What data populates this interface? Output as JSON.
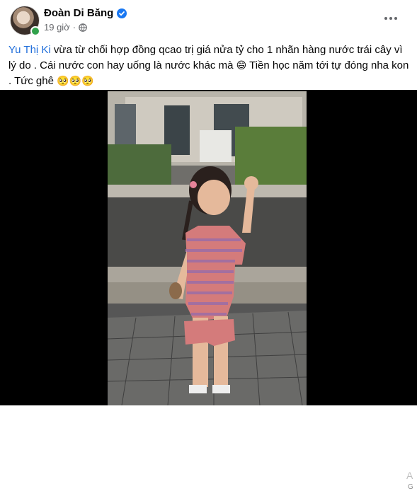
{
  "post": {
    "author": "Đoàn Di Băng",
    "time": "19 giờ",
    "mention": "Yu Thị Ki",
    "text_1": " vừa từ chối hợp đồng qcao trị giá nửa tỷ cho 1 nhãn hàng nước trái cây vì lý do . Cái nước con hay uống là nước khác mà ",
    "emoji_1": "😄",
    "text_2": " Tiền học năm tới tự đóng nha kon . Tức ghê ",
    "emoji_2": "🥺🥺🥺"
  },
  "icons": {
    "verified": "verified-badge-icon",
    "audience": "globe-icon",
    "more": "more-options-icon"
  },
  "colors": {
    "mention": "#216fdb",
    "verified": "#1877f2",
    "online": "#31a24c",
    "meta_text": "#65676b"
  },
  "video": {
    "side_text": "A",
    "side_text_2": "G"
  }
}
